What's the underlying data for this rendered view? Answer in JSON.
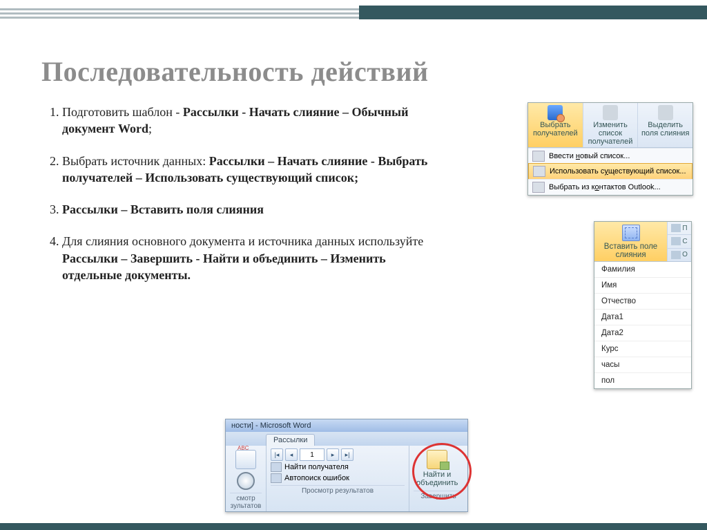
{
  "title": "Последовательность действий",
  "list": {
    "i1a": "Подготовить шаблон - ",
    "i1b": "Рассылки - Начать слияние – Обычный документ Word",
    "i1c": ";",
    "i2a": "Выбрать источник данных: ",
    "i2b": "Рассылки – Начать слияние - Выбрать получателей – Использовать существующий список;",
    "i3b": "Рассылки – Вставить поля слияния",
    "i4a": "Для слияния основного документа и источника данных используйте ",
    "i4b": "Рассылки – Завершить - Найти и объединить – Изменить отдельные документы."
  },
  "panel1": {
    "btn1": "Выбрать получателей",
    "btn2": "Изменить список получателей",
    "btn3": "Выделить поля слияния",
    "m1a": "Ввести ",
    "m1u": "н",
    "m1b": "овый список...",
    "m2a": "Использовать с",
    "m2u": "у",
    "m2b": "ществующий список...",
    "m3a": "Выбрать из к",
    "m3u": "о",
    "m3b": "нтактов Outlook..."
  },
  "panel2": {
    "main": "Вставить поле слияния",
    "side1": "П",
    "side2": "С",
    "side3": "О",
    "items": [
      "Фамилия",
      "Имя",
      "Отчество",
      "Дата1",
      "Дата2",
      "Курс",
      "часы",
      "пол"
    ]
  },
  "panel3": {
    "title": "ности] - Microsoft Word",
    "tab": "Рассылки",
    "leftcap": "смотр зультатов",
    "navval": "1",
    "find": "Найти получателя",
    "auto": "Автопоиск ошибок",
    "groupcap": "Просмотр результатов",
    "bigbtn1": "Найти и объединить",
    "bigbtn2": "Завершить"
  }
}
